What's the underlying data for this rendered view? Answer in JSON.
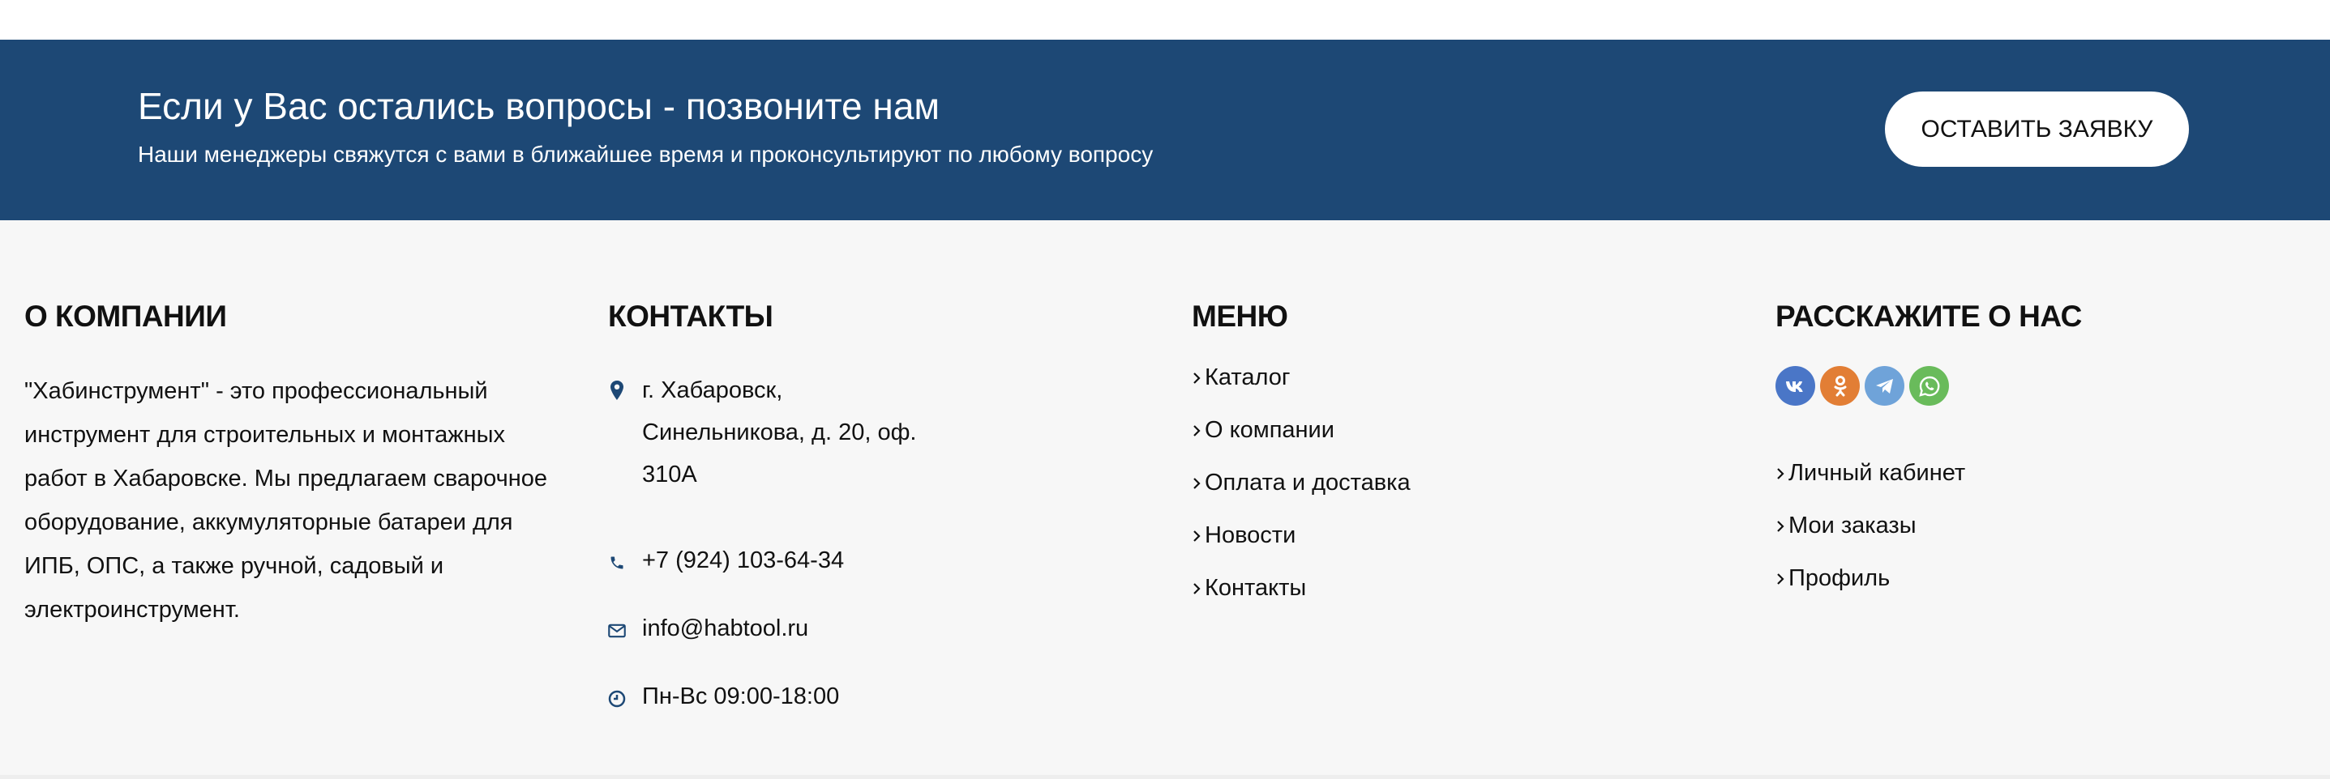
{
  "cta_banner": {
    "title": "Если у Вас остались вопросы - позвоните нам",
    "subtitle": "Наши менеджеры свяжутся с вами в ближайшее время и проконсультируют по любому вопросу",
    "button_label": "ОСТАВИТЬ ЗАЯВКУ",
    "background_color": "#1d4875"
  },
  "footer": {
    "about": {
      "title": "О КОМПАНИИ",
      "text": "\"Хабинструмент\" - это профессиональный инструмент для строительных и монтажных работ в Хабаровске. Мы предлагаем сварочное оборудование, аккумуляторные батареи для ИПБ, ОПС, а также ручной, садовый и электроинструмент."
    },
    "contacts": {
      "title": "КОНТАКТЫ",
      "address_line1": "г. Хабаровск,",
      "address_line2": "Синельникова, д. 20, оф.",
      "address_line3": "310А",
      "phone": "+7 (924) 103-64-34",
      "email": "info@habtool.ru",
      "hours": "Пн-Вс 09:00-18:00",
      "icons": [
        "location-pin-icon",
        "phone-icon",
        "mail-icon",
        "clock-icon"
      ]
    },
    "menu": {
      "title": "МЕНЮ",
      "items": [
        "Каталог",
        "О компании",
        "Оплата и доставка",
        "Новости",
        "Контакты"
      ]
    },
    "share": {
      "title": "РАССКАЖИТЕ О НАС",
      "social": [
        {
          "name": "vk-icon",
          "glyph": "vk",
          "color": "#4a76c7"
        },
        {
          "name": "odnoklassniki-icon",
          "glyph": "ok",
          "color": "#e27e35"
        },
        {
          "name": "telegram-icon",
          "glyph": "tg",
          "color": "#6fa3d9"
        },
        {
          "name": "whatsapp-icon",
          "glyph": "wa",
          "color": "#69bb5b"
        }
      ],
      "account_links": [
        "Личный кабинет",
        "Мои заказы",
        "Профиль"
      ]
    }
  }
}
